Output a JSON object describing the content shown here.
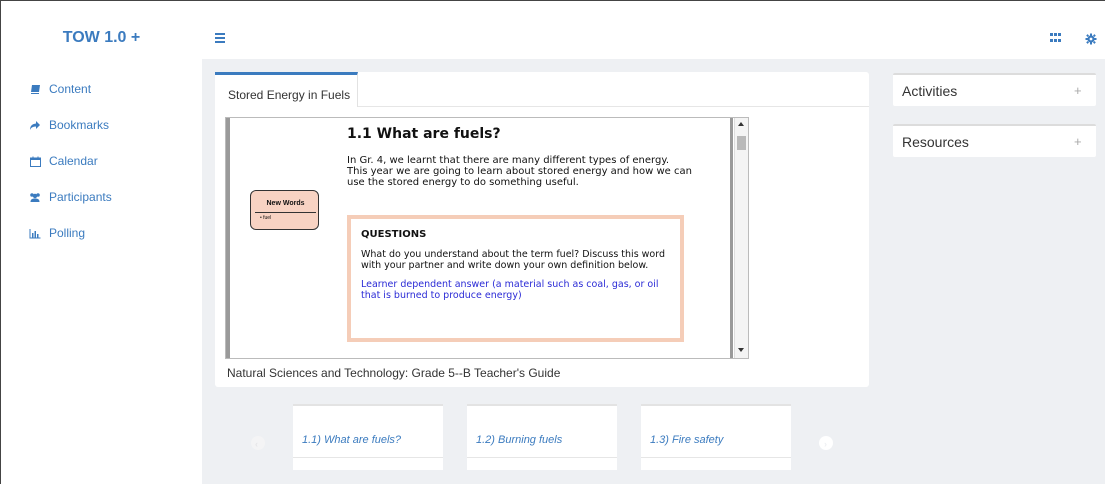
{
  "app": {
    "brand": "TOW 1.0 +"
  },
  "sidebar": {
    "items": [
      {
        "label": "Content",
        "icon": "book-icon"
      },
      {
        "label": "Bookmarks",
        "icon": "share-arrow-icon"
      },
      {
        "label": "Calendar",
        "icon": "calendar-icon"
      },
      {
        "label": "Participants",
        "icon": "users-icon"
      },
      {
        "label": "Polling",
        "icon": "bar-chart-icon"
      }
    ]
  },
  "topbar": {
    "menu_icon": "hamburger-icon",
    "apps_icon": "grid-icon",
    "settings_icon": "gear-icon"
  },
  "main": {
    "tab": "Stored Energy in Fuels",
    "document": {
      "heading": "1.1   What are fuels?",
      "intro": "In Gr. 4, we learnt that there are many different types of energy. This year we are going to learn about stored energy and how we can use the stored energy to do something useful.",
      "new_words_title": "New Words",
      "new_words_item": "•  fuel",
      "questions_title": "QUESTIONS",
      "questions_body": "What do you understand about the term fuel?  Discuss this word with your partner and write down your own definition below.",
      "questions_answer": "Learner dependent answer (a material such as coal, gas, or oil that is burned to produce energy)"
    },
    "caption": "Natural Sciences and Technology: Grade 5--B Teacher's Guide"
  },
  "right_panel": {
    "cards": [
      {
        "title": "Activities",
        "action": "+"
      },
      {
        "title": "Resources",
        "action": "+"
      }
    ]
  },
  "carousel": {
    "items": [
      {
        "label": "1.1) What are fuels?"
      },
      {
        "label": "1.2) Burning fuels"
      },
      {
        "label": "1.3) Fire safety"
      }
    ],
    "prev": "‹",
    "next": "›"
  },
  "colors": {
    "accent": "#3b7bbf",
    "background": "#eef0f3",
    "questions_border": "#f5cdb8",
    "answer_text": "#2b2bd6"
  }
}
